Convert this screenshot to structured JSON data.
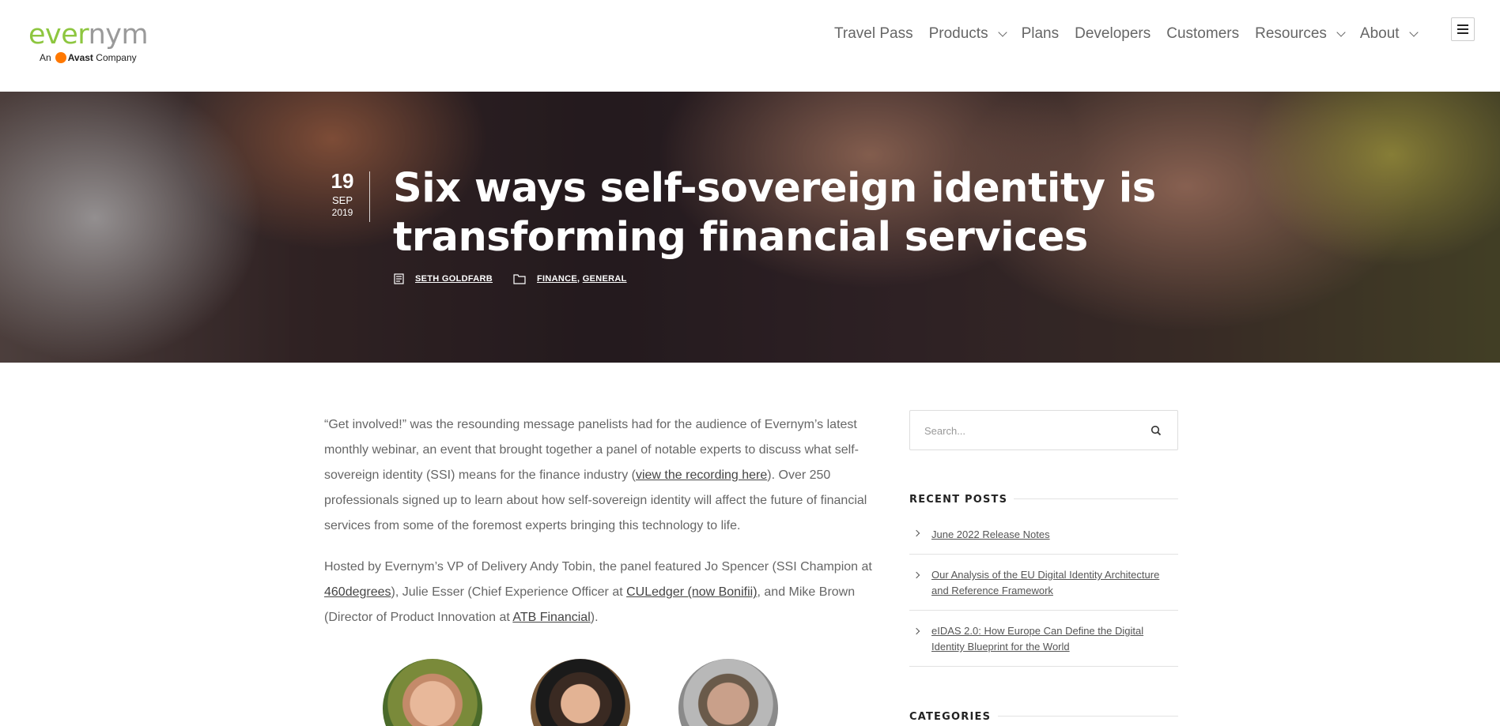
{
  "brand": {
    "logo_prefix": "e",
    "logo_ver": "ver",
    "logo_nym": "nym",
    "subtitle_pre": "An",
    "subtitle_brand": "Avast",
    "subtitle_post": "Company",
    "accent_color": "#8dc63f",
    "avast_color": "#ff7800"
  },
  "nav": {
    "items": [
      {
        "label": "Travel Pass",
        "has_dropdown": false
      },
      {
        "label": "Products",
        "has_dropdown": true
      },
      {
        "label": "Plans",
        "has_dropdown": false
      },
      {
        "label": "Developers",
        "has_dropdown": false
      },
      {
        "label": "Customers",
        "has_dropdown": false
      },
      {
        "label": "Resources",
        "has_dropdown": true
      },
      {
        "label": "About",
        "has_dropdown": true
      }
    ],
    "menu_icon": "hamburger-icon"
  },
  "post": {
    "day": "19",
    "month": "SEP",
    "year": "2019",
    "title": "Six ways self-sovereign identity is transforming financial services",
    "author": "SETH GOLDFARB",
    "categories": [
      "FINANCE",
      "GENERAL"
    ],
    "category_separator": ","
  },
  "body": {
    "p1_a": "“Get involved!” was the resounding message panelists had for the audience of Evernym’s latest monthly webinar, an event that brought together a panel of notable experts to discuss what self-sovereign identity (SSI) means for the finance industry (",
    "p1_link": "view the recording here",
    "p1_b": "). Over 250 professionals signed up to learn about how self-sovereign identity will affect the future of financial services from some of the foremost experts bringing this technology to life.",
    "p2_a": "Hosted by Evernym’s VP of Delivery Andy Tobin, the panel featured Jo Spencer (SSI Champion at ",
    "p2_link1": "460degrees",
    "p2_b": "), Julie Esser (Chief Experience Officer at ",
    "p2_link2": "CULedger (now Bonifii)",
    "p2_c": ", and Mike Brown (Director of Product Innovation at ",
    "p2_link3": "ATB Financial",
    "p2_d": ")."
  },
  "sidebar": {
    "search_placeholder": "Search...",
    "recent_heading": "RECENT POSTS",
    "recent_posts": [
      "June 2022 Release Notes",
      "Our Analysis of the EU Digital Identity Architecture and Reference Framework",
      "eIDAS 2.0: How Europe Can Define the Digital Identity Blueprint for the World"
    ],
    "categories_heading": "CATEGORIES"
  }
}
